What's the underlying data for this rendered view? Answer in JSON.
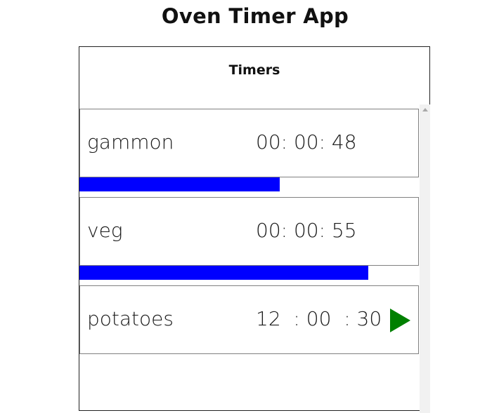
{
  "app": {
    "title": "Oven Timer App"
  },
  "panel": {
    "header": "Timers"
  },
  "timers": [
    {
      "name": "gammon",
      "time": "00: 00: 48",
      "progress": 0.59,
      "running": true
    },
    {
      "name": "veg",
      "time": "00: 00: 55",
      "progress": 0.85,
      "running": true
    },
    {
      "name": "potatoes",
      "time": "12  : 00  : 30",
      "running": false,
      "play_icon": "play-icon",
      "play_color": "#008000"
    }
  ],
  "colors": {
    "progress": "#0000ff",
    "play": "#008000"
  }
}
